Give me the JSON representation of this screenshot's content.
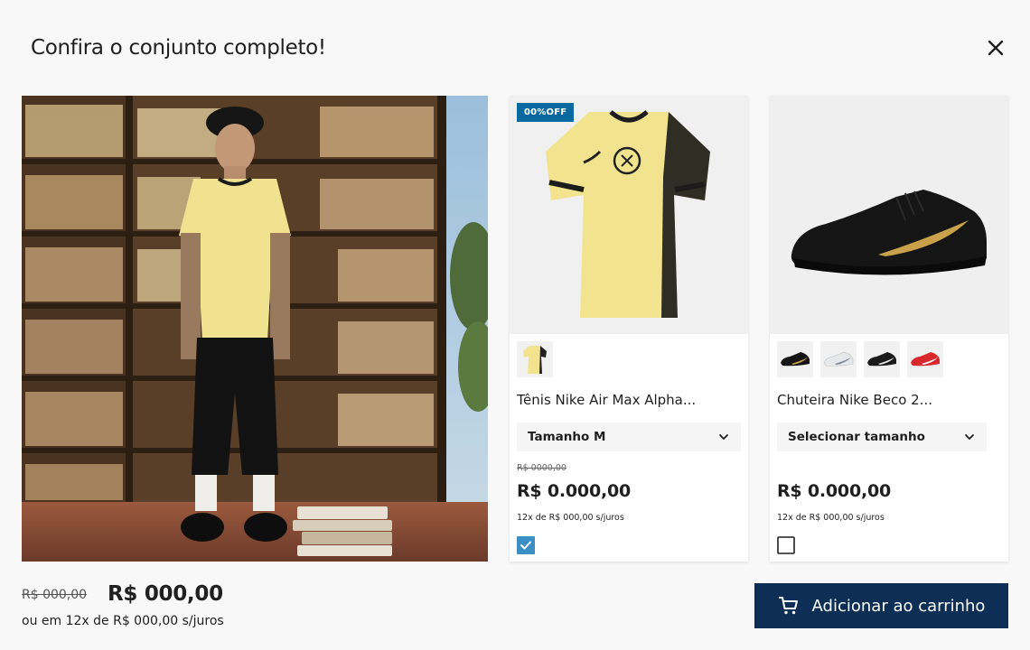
{
  "modal": {
    "title": "Confira o conjunto completo!"
  },
  "products": [
    {
      "badge": "00%OFF",
      "name": "Tênis Nike Air Max Alpha...",
      "size_label": "Tamanho M",
      "old_price": "R$ 0000,00",
      "price": "R$ 0.000,00",
      "installments": "12x de R$ 000,00 s/juros",
      "checked": true,
      "thumbnails": [
        "yellow-jersey"
      ]
    },
    {
      "name": "Chuteira Nike Beco 2...",
      "size_label": "Selecionar tamanho",
      "price": "R$ 0.000,00",
      "installments": "12x de R$ 000,00 s/juros",
      "checked": false,
      "thumbnails": [
        "black-gold-shoe",
        "white-shoe",
        "black-shoe",
        "red-shoe"
      ]
    }
  ],
  "summary": {
    "old_total": "R$ 000,00",
    "total": "R$ 000,00",
    "installments": "ou em 12x de R$ 000,00 s/juros"
  },
  "cart_button": {
    "label": "Adicionar ao carrinho",
    "icon": "cart-icon"
  },
  "colors": {
    "primary": "#0d2f55",
    "badge": "#0a6aa0",
    "checkbox": "#3b8fc4",
    "jersey": "#f0e28e"
  }
}
